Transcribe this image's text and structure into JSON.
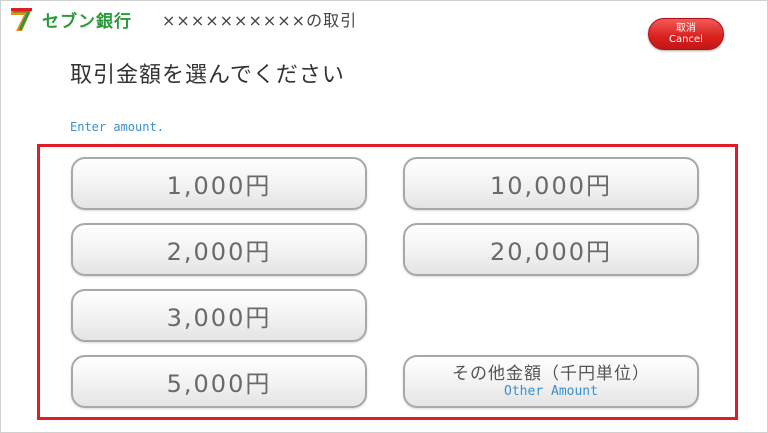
{
  "header": {
    "brand_name": "セブン銀行",
    "transaction_title": "××××××××××の取引"
  },
  "cancel_button": {
    "label_jp": "取消",
    "label_en": "Cancel",
    "color": "#d8201e"
  },
  "prompt": {
    "title": "取引金額を選んでください",
    "subtitle_en": "Enter amount."
  },
  "highlight_color": "#e01c24",
  "amounts": {
    "a1000": "1,000円",
    "a2000": "2,000円",
    "a3000": "3,000円",
    "a5000": "5,000円",
    "a10000": "10,000円",
    "a20000": "20,000円"
  },
  "other_amount": {
    "label_jp": "その他金額（千円単位）",
    "label_en": "Other Amount"
  }
}
